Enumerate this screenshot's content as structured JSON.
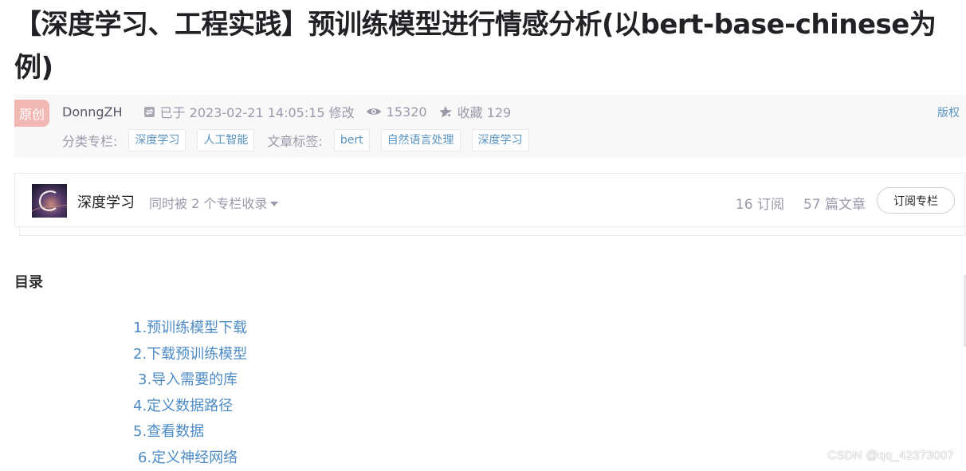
{
  "article": {
    "title": "【深度学习、工程实践】预训练模型进行情感分析(以bert-base-chinese为例)"
  },
  "meta": {
    "original_badge": "原创",
    "author": "DonngZH",
    "modified": "已于 2023-02-21 14:05:15 修改",
    "views": "15320",
    "favorites": "收藏 129",
    "copyright_link": "版权",
    "category_label": "分类专栏:",
    "categories": [
      "深度学习",
      "人工智能"
    ],
    "tags_label": "文章标签:",
    "tags": [
      "bert",
      "自然语言处理",
      "深度学习"
    ]
  },
  "column": {
    "name": "深度学习",
    "also_included": "同时被 2 个专栏收录",
    "subscribers": "16 订阅",
    "articles": "57 篇文章",
    "subscribe_button": "订阅专栏"
  },
  "toc": {
    "heading": "目录",
    "items": [
      "1.预训练模型下载",
      "2.下载预训练模型",
      "3.导入需要的库",
      "4.定义数据路径",
      "5.查看数据",
      "6.定义神经网络"
    ]
  },
  "watermark": "CSDN @qq_42373007",
  "colors": {
    "link": "#4d8bc5",
    "tag_text": "#5893c2",
    "badge_bg": "#f2b9b4",
    "meta_bg": "#f8f8f8"
  }
}
